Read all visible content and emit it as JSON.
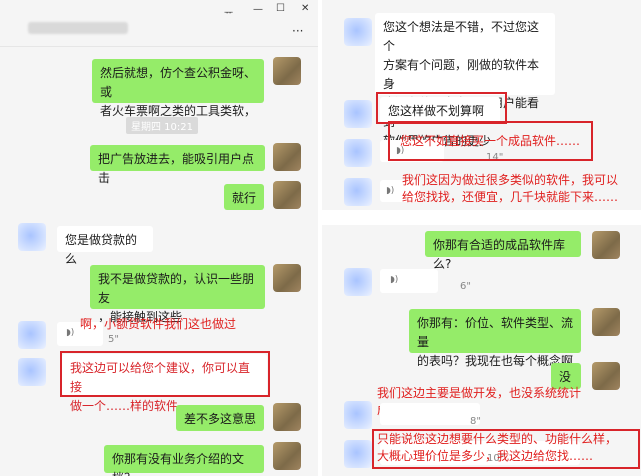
{
  "left": {
    "titlebar": {
      "pin_icon": "pin-icon",
      "minimize_icon": "minimize-icon",
      "maximize_icon": "maximize-icon",
      "close_icon": "close-icon",
      "more_icon": "more-icon",
      "pin_glyph": "ᅲ",
      "minimize_glyph": "—",
      "maximize_glyph": "☐",
      "close_glyph": "✕",
      "more_glyph": "···"
    },
    "timestamp": "星期四 10:21",
    "messages": [
      "然后就想，仿个查公积金呀、或\n者火车票啊之类的工具类软，",
      "把广告放进去，能吸引用户点击",
      "就行",
      "您是做贷款的么",
      "我不是做贷款的，认识一些朋友\n，能接触到这些",
      "我这边可以给您个建议，你可以直接\n做一个……样的软件。",
      "差不多这意思",
      "你那有没有业务介绍的文档？"
    ],
    "voice_duration": "5\"",
    "annotation": "啊，小额贷软件我们这也做过"
  },
  "right_top": {
    "messages": [
      "您这个想法是不错，不过您这个\n方案有个问题，刚做的软件本身\n也没有什么客户量，用户能看到\n软件里的广告的更少",
      "您这样做不划算啊"
    ],
    "voice_duration": "14\"",
    "annotations": [
      "您这不如直接买一个成品软件……",
      "我们这因为做过很多类似的软件，我可以\n给您找找，还便宜，几千块就能下来……"
    ]
  },
  "right_bottom": {
    "messages": [
      "你那有合适的成品软件库么?",
      "你那有：价位、软件类型、流量\n的表吗？我现在也每个概念啊",
      "没",
      "只能说您这边想要什么类型的、功能什么样，\n大概心理价位是多少，我这边给您找……"
    ],
    "voice_durations": [
      "6\"",
      "8\"",
      "10\""
    ],
    "annotation": "我们这边主要是做开发，也没系统统计\n成品业务。"
  },
  "colors": {
    "sent_bubble": "#95ec69",
    "received_bubble": "#ffffff",
    "panel_bg": "#f5f5f5",
    "annotation_red": "#e0201f"
  }
}
